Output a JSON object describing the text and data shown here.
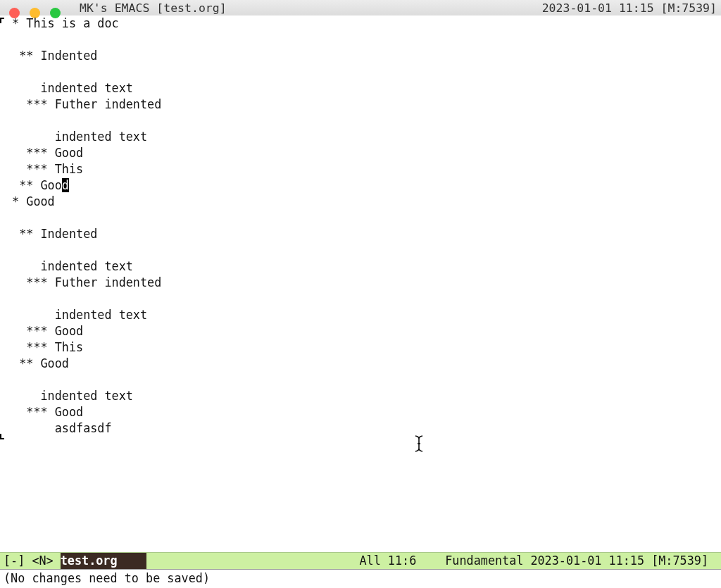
{
  "window": {
    "title": "MK's EMACS [test.org]",
    "clock": "2023-01-01 11:15 [M:7539]"
  },
  "buffer": {
    "lines": [
      {
        "kind": "text",
        "text": " * This is a doc"
      },
      {
        "kind": "blank"
      },
      {
        "kind": "text",
        "text": "  ** Indented"
      },
      {
        "kind": "blank"
      },
      {
        "kind": "text",
        "text": "     indented text"
      },
      {
        "kind": "text",
        "text": "   *** Futher indented"
      },
      {
        "kind": "blank"
      },
      {
        "kind": "text",
        "text": "       indented text"
      },
      {
        "kind": "text",
        "text": "   *** Good"
      },
      {
        "kind": "text",
        "text": "   *** This"
      },
      {
        "kind": "cursor",
        "text": "  ** Goo",
        "cursor": "d"
      },
      {
        "kind": "text",
        "text": " * Good"
      },
      {
        "kind": "blank"
      },
      {
        "kind": "text",
        "text": "  ** Indented"
      },
      {
        "kind": "blank"
      },
      {
        "kind": "text",
        "text": "     indented text"
      },
      {
        "kind": "text",
        "text": "   *** Futher indented"
      },
      {
        "kind": "blank"
      },
      {
        "kind": "text",
        "text": "       indented text"
      },
      {
        "kind": "text",
        "text": "   *** Good"
      },
      {
        "kind": "text",
        "text": "   *** This"
      },
      {
        "kind": "text",
        "text": "  ** Good"
      },
      {
        "kind": "blank"
      },
      {
        "kind": "text",
        "text": "     indented text"
      },
      {
        "kind": "text",
        "text": "   *** Good"
      },
      {
        "kind": "text",
        "text": "       asdfasdf"
      }
    ]
  },
  "mode_line": {
    "flags": "[-] <N>",
    "buffer_name": "test.org",
    "position": "All 11:6",
    "mode": "Fundamental",
    "clock": "2023-01-01 11:15 [M:7539]"
  },
  "echo_area": "(No changes need to be saved)"
}
